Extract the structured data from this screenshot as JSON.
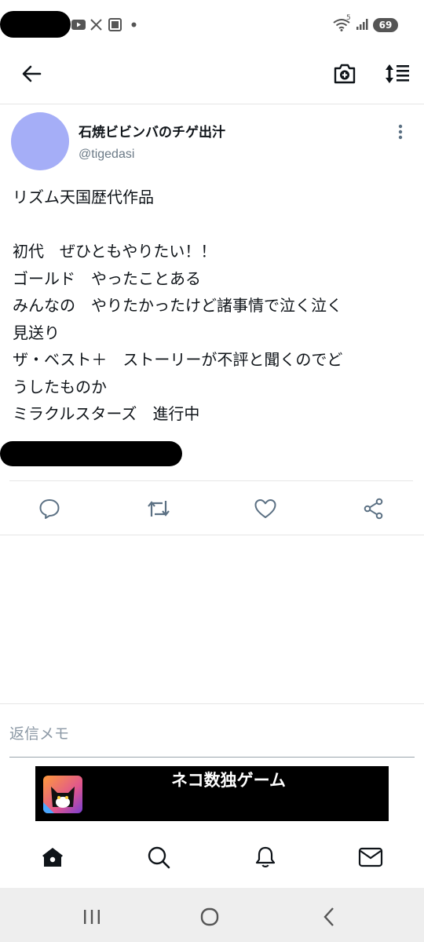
{
  "status_bar": {
    "battery": "69",
    "signal_label": "5"
  },
  "app_bar": {
    "back_icon": "arrow-left-icon",
    "camera_icon": "camera-plus-icon",
    "sort_icon": "sort-list-icon"
  },
  "tweet": {
    "author_name": "石焼ビビンバのチゲ出汁",
    "author_handle": "@tigedasi",
    "lines": [
      "リズム天国歴代作品",
      "",
      "初代　ぜひともやりたい！！",
      "ゴールド　やったことある",
      "みんなの　やりたかったけど諸事情で泣く泣く",
      "見送り",
      "ザ・ベスト＋　ストーリーが不評と聞くのでど",
      "うしたものか",
      "ミラクルスターズ　進行中"
    ]
  },
  "actions": {
    "reply_icon": "comment-icon",
    "retweet_icon": "retweet-icon",
    "like_icon": "heart-icon",
    "share_icon": "share-icon"
  },
  "reply": {
    "placeholder": "返信メモ"
  },
  "ad": {
    "title": "ネコ数独ゲーム"
  },
  "bottom_nav": {
    "items": [
      "home-icon",
      "search-icon",
      "bell-icon",
      "mail-icon"
    ]
  },
  "colors": {
    "avatar": "#a5aef7",
    "action_icon": "#5b7083",
    "text": "#0f1419",
    "secondary_text": "#6b7a87"
  }
}
